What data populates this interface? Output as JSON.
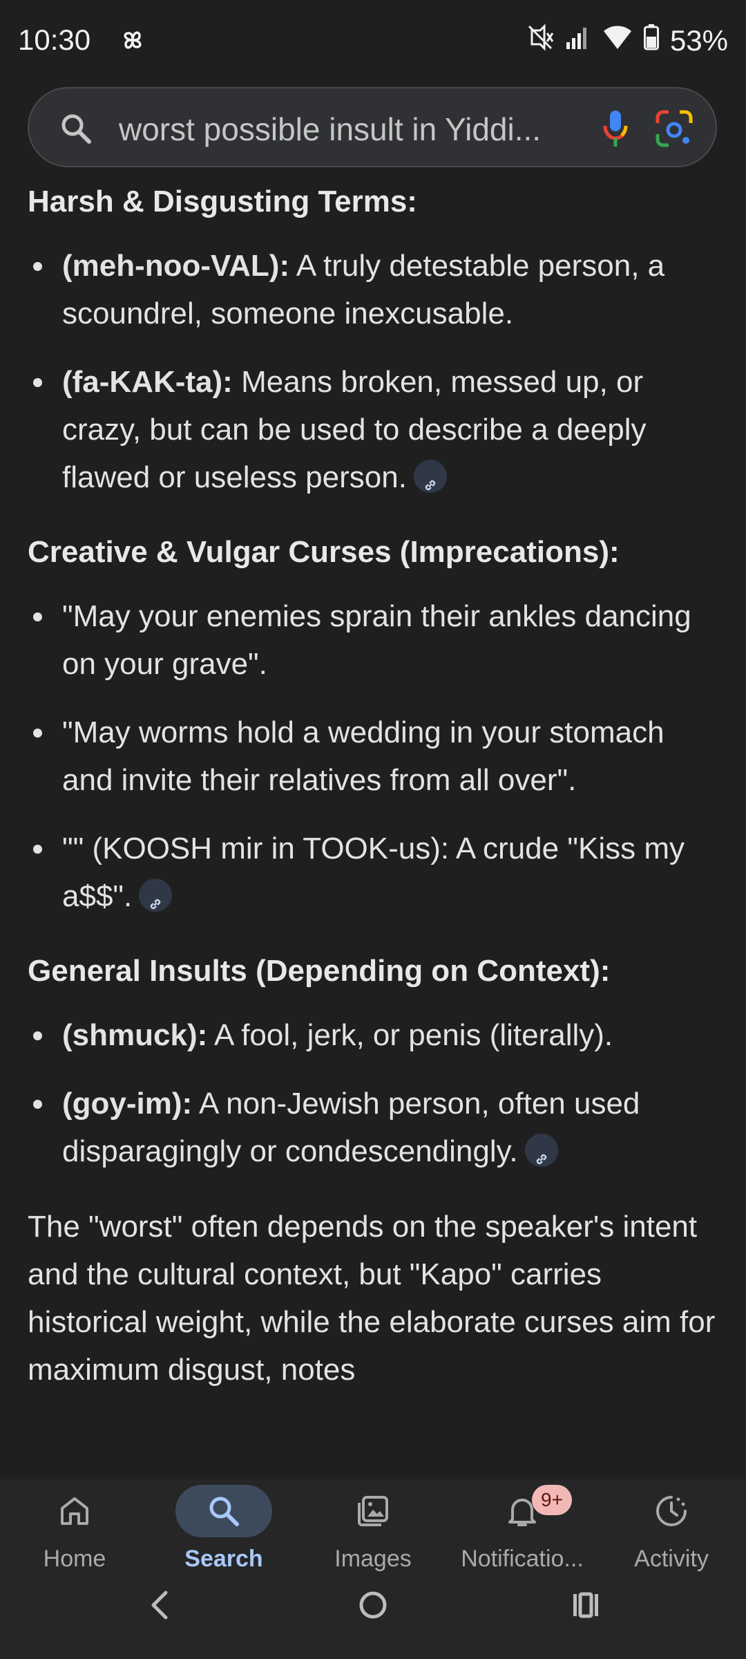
{
  "status_bar": {
    "time": "10:30",
    "battery": "53%"
  },
  "search": {
    "query": "worst possible insult in Yiddi..."
  },
  "content": {
    "section1": {
      "heading": "Harsh & Disgusting Terms:",
      "items": [
        {
          "term": "(meh-noo-VAL):",
          "desc": " A truly detestable person, a scoundrel, someone inexcusable."
        },
        {
          "term": "(fa-KAK-ta):",
          "desc": " Means broken, messed up, or crazy, but can be used to describe a deeply flawed or useless person."
        }
      ]
    },
    "section2": {
      "heading": "Creative & Vulgar Curses (Imprecations):",
      "items": [
        "\"May your enemies sprain their ankles dancing on your grave\".",
        "\"May worms hold a wedding in your stomach and invite their relatives from all over\".",
        "\"\" (KOOSH mir in TOOK-us): A crude \"Kiss my a$$\"."
      ]
    },
    "section3": {
      "heading": "General Insults (Depending on Context):",
      "items": [
        {
          "term": "(shmuck):",
          "desc": " A fool, jerk, or penis (literally)."
        },
        {
          "term": "(goy-im):",
          "desc": " A non-Jewish person, often used disparagingly or condescendingly."
        }
      ]
    },
    "summary": "The \"worst\" often depends on the speaker's intent and the cultural context, but \"Kapo\" carries historical weight, while the elaborate curses aim for maximum disgust, notes"
  },
  "bottom_nav": {
    "items": [
      {
        "label": "Home"
      },
      {
        "label": "Search"
      },
      {
        "label": "Images"
      },
      {
        "label": "Notificatio..."
      },
      {
        "label": "Activity"
      }
    ],
    "notification_badge": "9+"
  },
  "colors": {
    "background": "#1f1f1f",
    "accent": "#a8c7fa",
    "badge": "#f2b8b5"
  }
}
